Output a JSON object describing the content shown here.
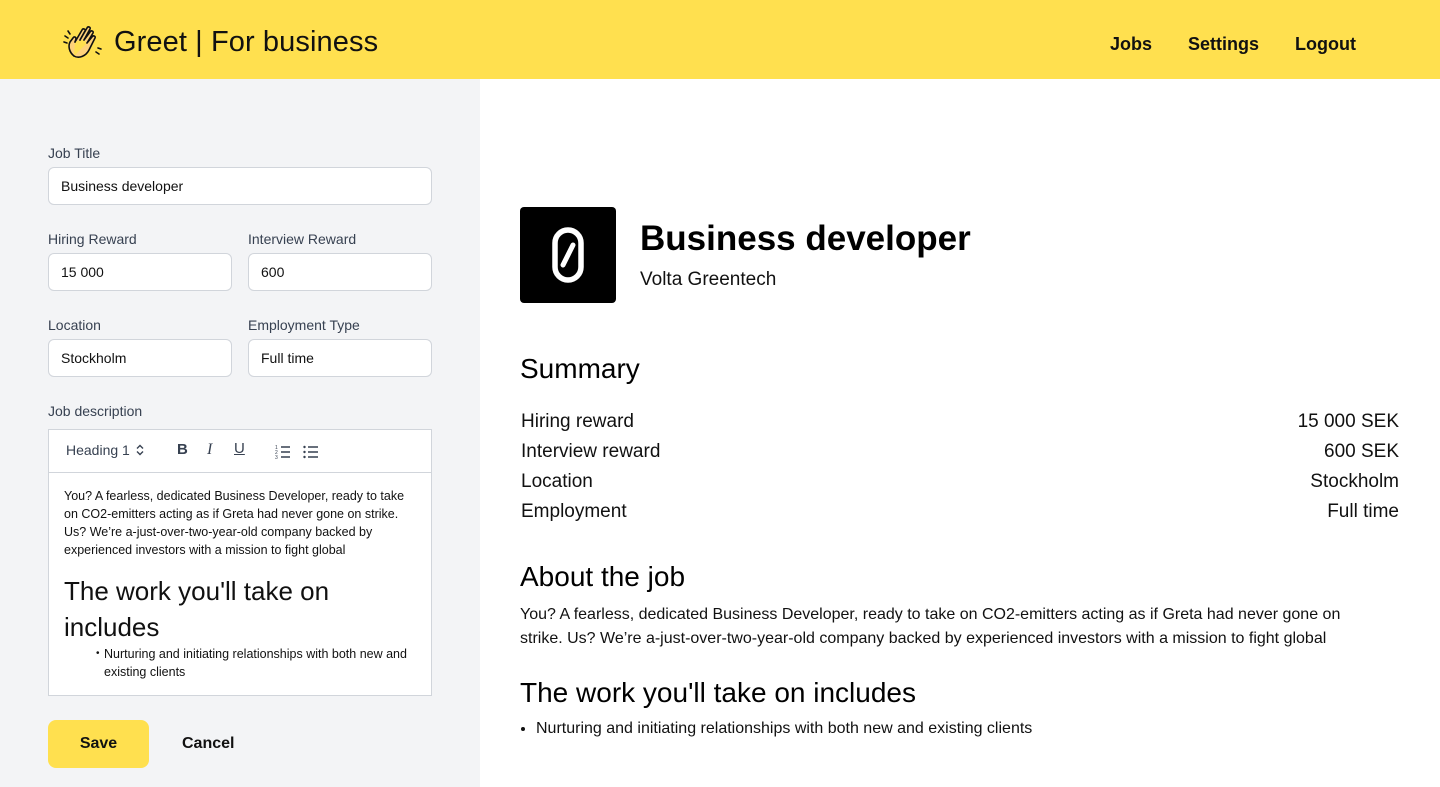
{
  "header": {
    "brand": "Greet | For business",
    "nav": [
      "Jobs",
      "Settings",
      "Logout"
    ]
  },
  "form": {
    "job_title_label": "Job Title",
    "job_title_value": "Business developer",
    "hiring_reward_label": "Hiring Reward",
    "hiring_reward_value": "15 000",
    "interview_reward_label": "Interview Reward",
    "interview_reward_value": "600",
    "location_label": "Location",
    "location_value": "Stockholm",
    "employment_type_label": "Employment Type",
    "employment_type_value": "Full time",
    "description_label": "Job description",
    "toolbar": {
      "heading_select": "Heading 1",
      "icons": [
        "bold-icon",
        "italic-icon",
        "underline-icon",
        "ordered-list-icon",
        "bullet-list-icon"
      ]
    },
    "editor": {
      "paragraph": "You? A fearless, dedicated Business Developer, ready to take on CO2-emitters acting as if Greta had never gone on strike. Us? We’re a-just-over-two-year-old company backed by experienced investors with a mission to fight global",
      "heading": "The work you'll take on includes",
      "bullet": "Nurturing and initiating relationships with both new and existing clients"
    },
    "save_label": "Save",
    "cancel_label": "Cancel"
  },
  "preview": {
    "logo_glyph": "0",
    "title": "Business developer",
    "company": "Volta Greentech",
    "summary_heading": "Summary",
    "summary": [
      {
        "label": "Hiring reward",
        "value": "15 000 SEK"
      },
      {
        "label": "Interview reward",
        "value": "600 SEK"
      },
      {
        "label": "Location",
        "value": "Stockholm"
      },
      {
        "label": "Employment",
        "value": "Full time"
      }
    ],
    "about_heading": "About the job",
    "about_text": "You? A fearless, dedicated Business Developer, ready to take on CO2-emitters acting as if Greta had never gone on strike. Us? We’re a-just-over-two-year-old company backed by experienced investors with a mission to fight global",
    "work_heading": "The work you'll take on includes",
    "work_items": [
      "Nurturing and initiating relationships with both new and existing clients"
    ]
  },
  "colors": {
    "accent": "#ffe04f",
    "panel": "#f3f4f6"
  }
}
